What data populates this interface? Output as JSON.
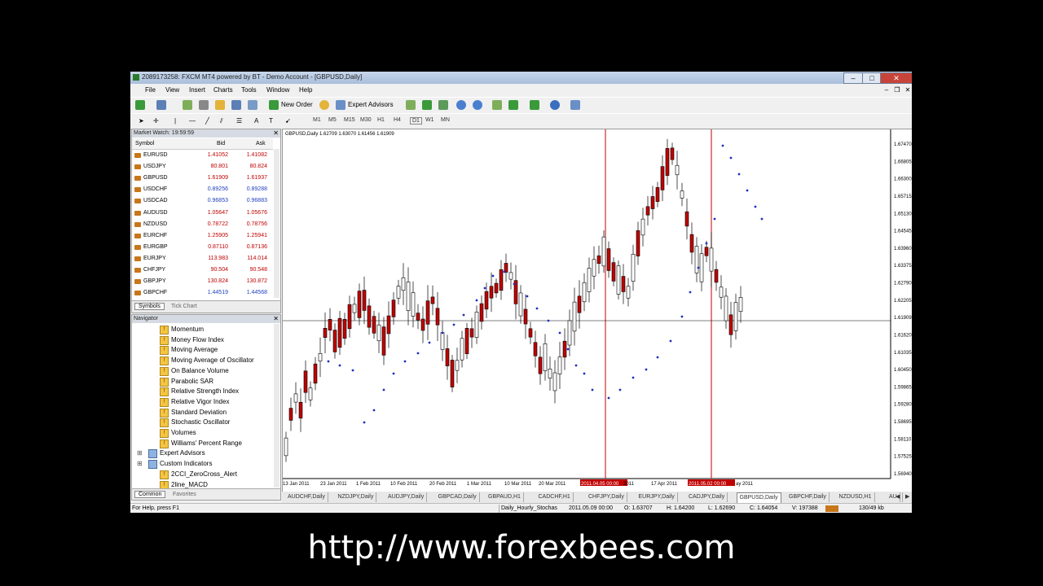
{
  "window": {
    "title": "2089173258: FXCM MT4 powered by BT - Demo Account - [GBPUSD,Daily]"
  },
  "menu": [
    "File",
    "View",
    "Insert",
    "Charts",
    "Tools",
    "Window",
    "Help"
  ],
  "toolbar": {
    "new_order": "New Order",
    "expert_advisors": "Expert Advisors"
  },
  "timeframes": [
    "M1",
    "M5",
    "M15",
    "M30",
    "H1",
    "H4",
    "D1",
    "W1",
    "MN"
  ],
  "tools_text": {
    "text_tool": "A",
    "label_tool": "T"
  },
  "market_watch": {
    "title": "Market Watch: 19:59:59",
    "headers": {
      "symbol": "Symbol",
      "bid": "Bid",
      "ask": "Ask"
    },
    "rows": [
      {
        "symbol": "EURUSD",
        "bid": "1.41052",
        "ask": "1.41082",
        "color": "#c00000"
      },
      {
        "symbol": "USDJPY",
        "bid": "80.801",
        "ask": "80.824",
        "color": "#c00000"
      },
      {
        "symbol": "GBPUSD",
        "bid": "1.61909",
        "ask": "1.61937",
        "color": "#c00000"
      },
      {
        "symbol": "USDCHF",
        "bid": "0.89256",
        "ask": "0.89288",
        "color": "#1f3fbf"
      },
      {
        "symbol": "USDCAD",
        "bid": "0.96853",
        "ask": "0.96883",
        "color": "#1f3fbf"
      },
      {
        "symbol": "AUDUSD",
        "bid": "1.05647",
        "ask": "1.05676",
        "color": "#c00000"
      },
      {
        "symbol": "NZDUSD",
        "bid": "0.78722",
        "ask": "0.78756",
        "color": "#c00000"
      },
      {
        "symbol": "EURCHF",
        "bid": "1.25905",
        "ask": "1.25941",
        "color": "#c00000"
      },
      {
        "symbol": "EURGBP",
        "bid": "0.87110",
        "ask": "0.87136",
        "color": "#c00000"
      },
      {
        "symbol": "EURJPY",
        "bid": "113.983",
        "ask": "114.014",
        "color": "#c00000"
      },
      {
        "symbol": "CHFJPY",
        "bid": "90.504",
        "ask": "90.548",
        "color": "#c00000"
      },
      {
        "symbol": "GBPJPY",
        "bid": "130.824",
        "ask": "130.872",
        "color": "#c00000"
      },
      {
        "symbol": "GBPCHF",
        "bid": "1.44519",
        "ask": "1.44568",
        "color": "#1f3fbf"
      }
    ],
    "tabs": [
      "Symbols",
      "Tick Chart"
    ]
  },
  "navigator": {
    "title": "Navigator",
    "items": [
      "Momentum",
      "Money Flow Index",
      "Moving Average",
      "Moving Average of Oscillator",
      "On Balance Volume",
      "Parabolic SAR",
      "Relative Strength Index",
      "Relative Vigor Index",
      "Standard Deviation",
      "Stochastic Oscillator",
      "Volumes",
      "Williams' Percent Range"
    ],
    "folders": [
      "Expert Advisors",
      "Custom Indicators"
    ],
    "custom": [
      "2CCI_ZeroCross_Alert",
      "2line_MACD"
    ],
    "tabs": [
      "Common",
      "Favorites"
    ]
  },
  "chart": {
    "header": "GBPUSD,Daily  1.62709 1.63070 1.61456 1.61909",
    "price_labels": [
      "1.67470",
      "1.66805",
      "1.66300",
      "1.65715",
      "1.65130",
      "1.64545",
      "1.63960",
      "1.63375",
      "1.62790",
      "1.62205",
      "1.61909",
      "1.61620",
      "1.61035",
      "1.60450",
      "1.59865",
      "1.59280",
      "1.58695",
      "1.58110",
      "1.57525",
      "1.56940"
    ],
    "current_price": "1.61909",
    "date_labels": [
      "13 Jan 2011",
      "23 Jan 2011",
      "1 Feb 2011",
      "10 Feb 2011",
      "20 Feb 2011",
      "1 Mar 2011",
      "10 Mar 2011",
      "20 Mar 2011",
      "2011.04.05 00:00",
      "2011",
      "17 Apr 2011",
      "2011.05.02 00:00",
      "ay 2011"
    ]
  },
  "chart_tabs": [
    "AUDCHF,Daily",
    "NZDJPY,Daily",
    "AUDJPY,Daily",
    "GBPCAD,Daily",
    "GBPAUD,H1",
    "CADCHF,H1",
    "CHFJPY,Daily",
    "EURJPY,Daily",
    "CADJPY,Daily",
    "GBPUSD,Daily",
    "GBPCHF,Daily",
    "NZDUSD,H1",
    "AU"
  ],
  "status": {
    "help": "For Help, press F1",
    "profile": "Daily_Hourly_Stochas",
    "datetime": "2011.05.09 00:00",
    "open": "O: 1.63707",
    "high": "H: 1.64200",
    "low": "L: 1.62690",
    "close": "C: 1.64054",
    "volume": "V: 197388",
    "traffic": "130/49 kb"
  },
  "watermark_url": "http://www.forexbees.com",
  "colors": {
    "bull": "#ffffff",
    "bear": "#c00000",
    "sar": "#1f2fbf",
    "vline": "#c00000"
  }
}
